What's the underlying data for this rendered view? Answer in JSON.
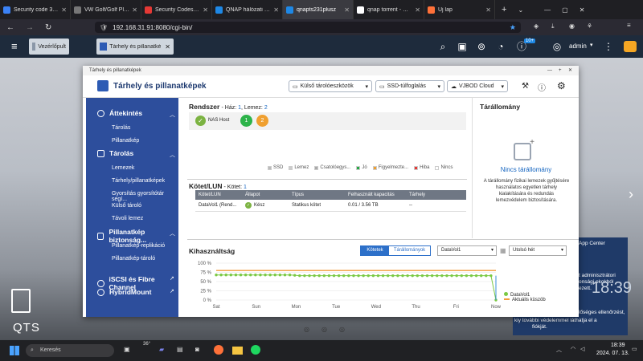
{
  "browser": {
    "tabs": [
      {
        "label": "Security code 31347",
        "color": "#3b82f6"
      },
      {
        "label": "VW Golf/Golf Plus (SK/52",
        "color": "#777777"
      },
      {
        "label": "Security Codes not w",
        "color": "#e53935"
      },
      {
        "label": "QNAP hálózati adatt",
        "color": "#1e88e5"
      },
      {
        "label": "qnapts231plusz",
        "color": "#1e88e5",
        "active": true
      },
      {
        "label": "qnap torrent - Google",
        "color": "#ffffff"
      },
      {
        "label": "Új lap",
        "color": "#ff7139"
      }
    ],
    "url": "192.168.31.91:8080/cgi-bin/",
    "new_tab": "+"
  },
  "qts": {
    "app_tabs": [
      {
        "label": "Vezérlőpult"
      },
      {
        "label": "Tárhely és pillanatké"
      }
    ],
    "notification_badge": "10+",
    "user": "admin",
    "logo": "QTS"
  },
  "window": {
    "title": "Tárhely és pillanatképek",
    "app_title": "Tárhely és pillanatképek",
    "buttons": {
      "external": "Külső tárolóeszközök",
      "ssd": "SSD-túlfoglalás",
      "vjbod": "VJBOD Cloud"
    }
  },
  "sidebar": {
    "sections": [
      {
        "label": "Áttekintés",
        "items": [
          "Tárolás",
          "Pillanatkép"
        ]
      },
      {
        "label": "Tárolás",
        "items": [
          "Lemezek",
          "Tárhely/pillanatképek",
          "Gyorsítás gyorsítótár segí...",
          "Külső tároló",
          "Távoli lemez"
        ]
      },
      {
        "label": "Pillanatkép biztonság...",
        "items": [
          "Pillanatkép-replikáció",
          "Pillanatkép-tároló"
        ]
      },
      {
        "label": "iSCSI és Fibre Channel",
        "items": []
      },
      {
        "label": "HybridMount",
        "items": []
      }
    ]
  },
  "system": {
    "title": "Rendszer",
    "sub_prefix": "- Ház: ",
    "haz": "1",
    "lemez_prefix": ", Lemez: ",
    "lemez": "2",
    "nas_label": "NAS Host",
    "disks": [
      "1",
      "2"
    ],
    "legend": [
      {
        "label": "SSD",
        "color": "#bbbbbb"
      },
      {
        "label": "Lemez",
        "color": "#cccccc"
      },
      {
        "label": "Csatolóegys...",
        "color": "#aaaaaa"
      },
      {
        "label": "Jó",
        "color": "#27a844"
      },
      {
        "label": "Figyelmezte...",
        "color": "#f0a030"
      },
      {
        "label": "Hiba",
        "color": "#e53935"
      },
      {
        "label": "Nincs",
        "color": "#ffffff"
      }
    ]
  },
  "volumes": {
    "title": "Kötet/LUN",
    "count_prefix": " - Kötet: ",
    "count": "1",
    "columns": [
      "Kötet/LUN",
      "Állapot",
      "Típus",
      "Felhasznált kapacitás",
      "Tárhely"
    ],
    "rows": [
      {
        "name": "DataVol1 (Rend...",
        "status": "Kész",
        "type": "Statikus kötet",
        "used": "0.01 / 3.56 TB",
        "pool": "--"
      }
    ]
  },
  "pool": {
    "title": "Tárállomány",
    "empty_title": "Nincs tárállomány",
    "description": "A tárállomány fizikai lemezek gyűjtésére használatos egyetlen tárhely kialakítására és redundás lemezvédelem biztosítására."
  },
  "usage": {
    "title": "Kihasználtság",
    "toggle": [
      "Kötetek",
      "Tárállományok"
    ],
    "volume_select": "DataVol1",
    "range_select": "Utolsó hét",
    "legend": [
      "DataVol1",
      "Aktuális küszöb"
    ]
  },
  "chart_data": {
    "type": "line",
    "categories": [
      "Sat",
      "Sun",
      "Mon",
      "Tue",
      "Wed",
      "Thu",
      "Fri",
      "Now"
    ],
    "ylim": [
      0,
      100
    ],
    "yticks": [
      "100 %",
      "75 %",
      "50 %",
      "25 %",
      "0 %"
    ],
    "threshold": 80,
    "series": [
      {
        "name": "DataVol1",
        "color": "#7ac943",
        "values": [
          68,
          68,
          68,
          68,
          68,
          68,
          68,
          68,
          68,
          68,
          68,
          68,
          68,
          68,
          68,
          68,
          67,
          66,
          66,
          66,
          66,
          66,
          66,
          66,
          66,
          66,
          66,
          66,
          66,
          66,
          66,
          66,
          66,
          66,
          66,
          66,
          66,
          66,
          66,
          66,
          66,
          66,
          66,
          66,
          66,
          66,
          66,
          66,
          66,
          66,
          66,
          66,
          66,
          66,
          66,
          66,
          66,
          0
        ]
      },
      {
        "name": "Aktuális küszöb",
        "color": "#f39c3c"
      }
    ]
  },
  "notification": {
    "app": "App Center",
    "line1": "t adminisztrátori",
    "line2": "onsági okokból",
    "line3": "ezett.",
    "line4": "lőséges ellenőrzést,",
    "line5": "kiy további védelemmel láthatja el a",
    "line6": "fiókját.",
    "big_time": "18:39"
  },
  "taskbar": {
    "search": "Keresés",
    "weather": "36°",
    "time": "18:39",
    "date": "2024. 07. 13."
  }
}
